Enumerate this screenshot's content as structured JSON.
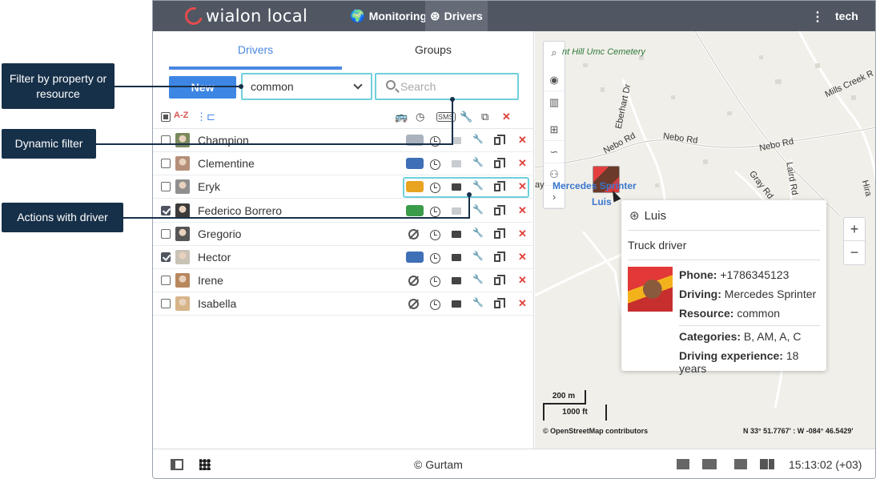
{
  "topbar": {
    "logo_text": "wialon local",
    "nav_monitoring": "Monitoring",
    "nav_drivers": "Drivers",
    "user": "tech"
  },
  "tabs": {
    "drivers": "Drivers",
    "groups": "Groups"
  },
  "toolbar": {
    "new_label": "New",
    "filter_value": "common",
    "search_placeholder": "Search"
  },
  "list_header": {
    "sort_icon": "A-Z",
    "sms_icon": "SMS"
  },
  "drivers": [
    {
      "name": "Champion",
      "checked": false,
      "vehicle": "car",
      "mail": "dim"
    },
    {
      "name": "Clementine",
      "checked": false,
      "vehicle": "van",
      "mail": "dim"
    },
    {
      "name": "Eryk",
      "checked": false,
      "vehicle": "bus-yellow",
      "mail": "on"
    },
    {
      "name": "Federico Borrero",
      "checked": true,
      "vehicle": "bus-green",
      "mail": "dim"
    },
    {
      "name": "Gregorio",
      "checked": false,
      "vehicle": "none",
      "mail": "on"
    },
    {
      "name": "Hector",
      "checked": true,
      "vehicle": "van",
      "mail": "on"
    },
    {
      "name": "Irene",
      "checked": false,
      "vehicle": "none",
      "mail": "on"
    },
    {
      "name": "Isabella",
      "checked": false,
      "vehicle": "none",
      "mail": "on"
    }
  ],
  "bottombar": {
    "copyright": "© Gurtam",
    "clock": "15:13:02 (+03)"
  },
  "map": {
    "cemetery": "nt Hill Umc Cemetery",
    "road1": "Nebo Rd",
    "road2": "Nebo Rd",
    "road3": "Nebo Rd",
    "road4": "Eberhart Dr",
    "road5": "Gray Rd",
    "road6": "Laird Rd",
    "road7": "Mills Creek R",
    "road8": "Hira",
    "marker_unit": "Mercedes Sprinter",
    "marker_unit_prefix": "ay",
    "marker_name": "Luis",
    "scale_m": "200 m",
    "scale_ft": "1000 ft",
    "osm": "© OpenStreetMap contributors",
    "coords": "N 33° 51.7767' : W -084° 46.5429'"
  },
  "popup": {
    "title": "Luis",
    "description": "Truck driver",
    "phone_label": "Phone:",
    "phone": "+1786345123",
    "driving_label": "Driving:",
    "driving": "Mercedes Sprinter",
    "resource_label": "Resource:",
    "resource": "common",
    "categories_label": "Categories:",
    "categories": "B, AM, A, C",
    "experience_label": "Driving experience:",
    "experience": "18 years"
  },
  "callouts": {
    "filter": "Filter by property or resource",
    "dynamic": "Dynamic filter",
    "actions": "Actions with driver"
  },
  "colors": {
    "accent": "#3d86e4",
    "topbar": "#505763",
    "callout": "#173049",
    "highlight": "#6fd0dc",
    "delete": "#e0403a"
  }
}
